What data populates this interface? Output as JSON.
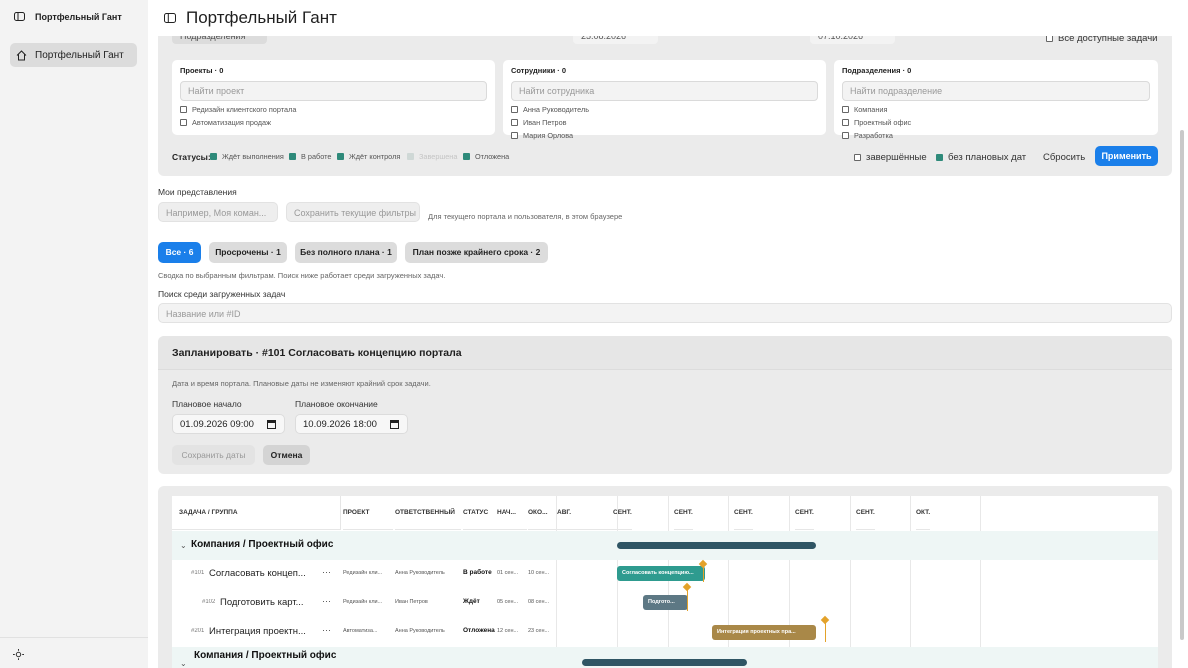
{
  "app": {
    "sidebar_title": "Портфельный Гант",
    "nav_item": "Портфельный Гант",
    "page_title": "Портфельный Гант"
  },
  "filters": {
    "top_row": {
      "subdivision_label": "Подразделения",
      "date_from": "25.08.2026",
      "date_to": "07.10.2026",
      "all_tasks": "Все доступные задачи"
    },
    "projects": {
      "title": "Проекты · 0",
      "placeholder": "Найти проект",
      "items": [
        "Редизайн клиентского портала",
        "Автоматизация продаж"
      ]
    },
    "employees": {
      "title": "Сотрудники · 0",
      "placeholder": "Найти сотрудника",
      "items": [
        "Анна Руководитель",
        "Иван Петров",
        "Мария Орлова"
      ]
    },
    "departments": {
      "title": "Подразделения · 0",
      "placeholder": "Найти подразделение",
      "items": [
        "Компания",
        "Проектный офис",
        "Разработка"
      ]
    },
    "statuses_label": "Статусы:",
    "statuses": [
      "Ждёт выполнения",
      "В работе",
      "Ждёт контроля",
      "Завершена",
      "Отложена"
    ],
    "completed": "завершённые",
    "no_dates": "без плановых дат",
    "reset": "Сбросить",
    "apply": "Применить"
  },
  "views": {
    "title": "Мои представления",
    "placeholder": "Например, Моя коман...",
    "save": "Сохранить текущие фильтры",
    "hint": "Для текущего портала и пользователя, в этом браузере"
  },
  "chips": [
    "Все · 6",
    "Просрочены · 1",
    "Без полного плана · 1",
    "План позже крайнего срока · 2"
  ],
  "summary_note": "Сводка по выбранным фильтрам. Поиск ниже работает среди загруженных задач.",
  "search": {
    "label": "Поиск среди загруженных задач",
    "placeholder": "Название или #ID"
  },
  "plan": {
    "title": "Запланировать · #101 Согласовать концепцию портала",
    "note": "Дата и время портала. Плановые даты не изменяют крайний срок задачи.",
    "start_label": "Плановое начало",
    "start_value": "01.09.2026 09:00",
    "end_label": "Плановое окончание",
    "end_value": "10.09.2026 18:00",
    "save": "Сохранить даты",
    "cancel": "Отмена"
  },
  "gantt": {
    "headers": [
      "ЗАДАЧА / ГРУППА",
      "ПРОЕКТ",
      "ОТВЕТСТВЕННЫЙ",
      "СТАТУС",
      "НАЧ...",
      "ОКО..."
    ],
    "months": [
      "АВГ.",
      "СЕНТ.",
      "СЕНТ.",
      "СЕНТ.",
      "СЕНТ.",
      "СЕНТ.",
      "ОКТ."
    ],
    "groups": [
      "Компания / Проектный офис",
      "Компания / Проектный офис"
    ],
    "rows": [
      {
        "id": "#101",
        "name": "Согласовать концеп...",
        "project": "Редизайн кли...",
        "owner": "Анна Руководитель",
        "status": "В работе",
        "start": "01 сен...",
        "end": "10 сен...",
        "bar": "Согласовать концепцию...",
        "color": "#2e9b8f"
      },
      {
        "id": "#102",
        "name": "Подготовить карт...",
        "project": "Редизайн кли...",
        "owner": "Иван Петров",
        "status": "Ждёт",
        "start": "05 сен...",
        "end": "08 сен...",
        "bar": "Подгото...",
        "color": "#5d7884"
      },
      {
        "id": "#201",
        "name": "Интеграция проектн...",
        "project": "Автоматиза...",
        "owner": "Анна Руководитель",
        "status": "Отложена",
        "start": "12 сен...",
        "end": "23 сен...",
        "bar": "Интеграция проектных пра...",
        "color": "#a98848"
      }
    ]
  }
}
